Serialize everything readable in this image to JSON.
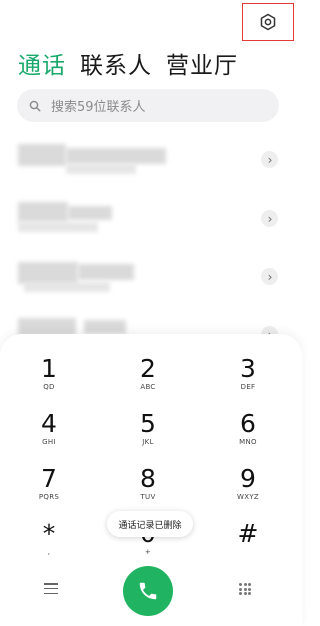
{
  "tabs": [
    "通话",
    "联系人",
    "营业厅"
  ],
  "search": {
    "placeholder": "搜索59位联系人"
  },
  "dialpad": {
    "keys": [
      {
        "digit": "1",
        "letters": "QD"
      },
      {
        "digit": "2",
        "letters": "ABC"
      },
      {
        "digit": "3",
        "letters": "DEF"
      },
      {
        "digit": "4",
        "letters": "GHI"
      },
      {
        "digit": "5",
        "letters": "JKL"
      },
      {
        "digit": "6",
        "letters": "MNO"
      },
      {
        "digit": "7",
        "letters": "PQRS"
      },
      {
        "digit": "8",
        "letters": "TUV"
      },
      {
        "digit": "9",
        "letters": "WXYZ"
      },
      {
        "digit": "*",
        "letters": ","
      },
      {
        "digit": "0",
        "letters": "+"
      },
      {
        "digit": "#",
        "letters": ""
      }
    ]
  },
  "toast": "通话记录已删除",
  "icons": {
    "settings": "gear-icon",
    "search": "search-icon",
    "chevron": "chevron-right-icon",
    "menu": "menu-icon",
    "call": "phone-icon",
    "dialpad": "dialpad-icon"
  },
  "colors": {
    "accent": "#19a96b",
    "call": "#20b462",
    "highlight": "#e53935"
  }
}
